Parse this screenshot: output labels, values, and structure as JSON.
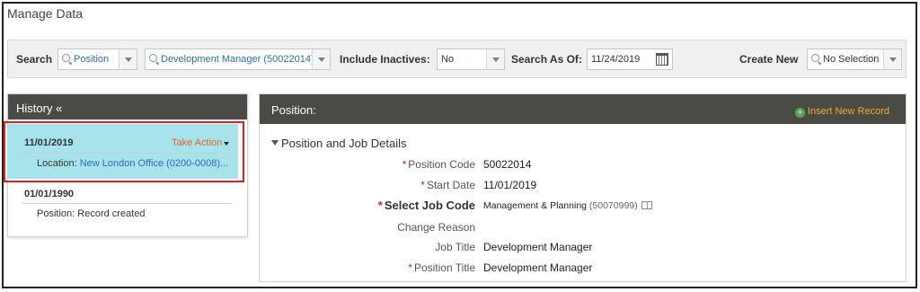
{
  "page": {
    "title": "Manage Data"
  },
  "search_bar": {
    "search_label": "Search",
    "search_type": "Position",
    "search_value": "Development Manager (50022014)",
    "include_inactives_label": "Include Inactives:",
    "include_inactives_value": "No",
    "search_as_of_label": "Search As Of:",
    "search_as_of_value": "11/24/2019",
    "create_new_label": "Create New",
    "create_new_value": "No Selection"
  },
  "history": {
    "title": "History «",
    "records": [
      {
        "date": "11/01/2019",
        "action": "Take Action",
        "detail_label": "Location:",
        "detail_value": "New London Office (0200-0008)..."
      },
      {
        "date": "01/01/1990",
        "detail_label": "Position:",
        "detail_value": "Record created"
      }
    ]
  },
  "position": {
    "title": "Position:",
    "insert_label": "Insert New Record",
    "section_title": "Position and Job Details",
    "fields": [
      {
        "label": "Position Code",
        "required": "*",
        "value": "50022014"
      },
      {
        "label": "Start Date",
        "required": "*",
        "value": "11/01/2019"
      },
      {
        "label": "Select Job Code",
        "required": "*",
        "value": "Management & Planning",
        "value_extra": "(50070999)"
      },
      {
        "label": "Change Reason",
        "required": "",
        "value": ""
      },
      {
        "label": "Job Title",
        "required": "",
        "value": "Development Manager"
      },
      {
        "label": "Position Title",
        "required": "*",
        "value": "Development Manager"
      }
    ]
  },
  "colors": {
    "header_bar": "#4b4b45",
    "selected_row": "#a7e3ea",
    "highlight_outline": "#e02020",
    "action_orange": "#e0662a",
    "link_blue": "#2a6ebb",
    "required_red": "#d0271d"
  }
}
